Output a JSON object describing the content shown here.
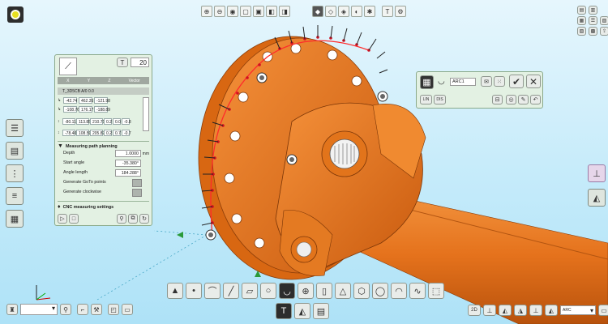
{
  "top_toolbar": {
    "icons": [
      "zoom-icon",
      "zoom-icon",
      "fit-icon",
      "view-front-icon",
      "view-top-icon",
      "view-side-icon",
      "view-iso-icon",
      "shaded-icon",
      "wireframe-icon",
      "hidden-icon",
      "section-icon",
      "measure-icon",
      "probe-icon"
    ]
  },
  "dialog": {
    "point_count": "20",
    "columns": [
      "X",
      "Y",
      "Z",
      "Vector"
    ],
    "path_name": "T_3D5CB A/0 0.0",
    "coord_rows": [
      [
        "-42.74",
        "462.35",
        "-121.98"
      ],
      [
        "-108.76",
        "176.17",
        "-188.89"
      ],
      [
        "-80.11",
        "113.85",
        "210.71",
        "0.2",
        "0.0",
        "-0.8"
      ],
      [
        "-78.40",
        "108.59",
        "205.87",
        "0.2",
        "0.7",
        "-0.7"
      ]
    ],
    "section_title": "Measuring path planning",
    "fields": [
      {
        "label": "Depth",
        "value": "1.0000",
        "unit": "mm"
      },
      {
        "label": "Start angle",
        "value": "-35.380°",
        "unit": ""
      },
      {
        "label": "Angle length",
        "value": "184.288°",
        "unit": ""
      }
    ],
    "checkboxes": [
      "Generate GoTo points",
      "Generate clockwise"
    ],
    "cnc_section": "CNC measuring settings"
  },
  "arc_panel": {
    "name": "ARC1",
    "buttons_row2": [
      "LIN",
      "DIS"
    ]
  },
  "bottom_left": {
    "dropdown_value": "",
    "icons": [
      "robot-icon",
      "dropdown-icon",
      "probe-icon",
      "step-icon",
      "tool-icon",
      "camera-icon",
      "square-icon"
    ]
  },
  "bottom_center": {
    "shape_icons": [
      "cone-icon",
      "point-icon",
      "plane-curve-icon",
      "line-icon",
      "plane-icon",
      "circle-icon",
      "arc-icon",
      "sphere-icon",
      "cylinder-icon",
      "cone-shape-icon",
      "polygon-icon",
      "ring-icon",
      "free-surface-icon",
      "spline-icon",
      "group-icon"
    ],
    "mode_icons": [
      "probe-mode-icon",
      "measure-mode-icon",
      "document-icon"
    ]
  },
  "bottom_right": {
    "label_2d": "2D",
    "dropdown_value": "ARC"
  },
  "colors": {
    "part_orange": "#e8751a",
    "panel_bg": "#e3f1e3",
    "sky": "#c5ebfa"
  }
}
